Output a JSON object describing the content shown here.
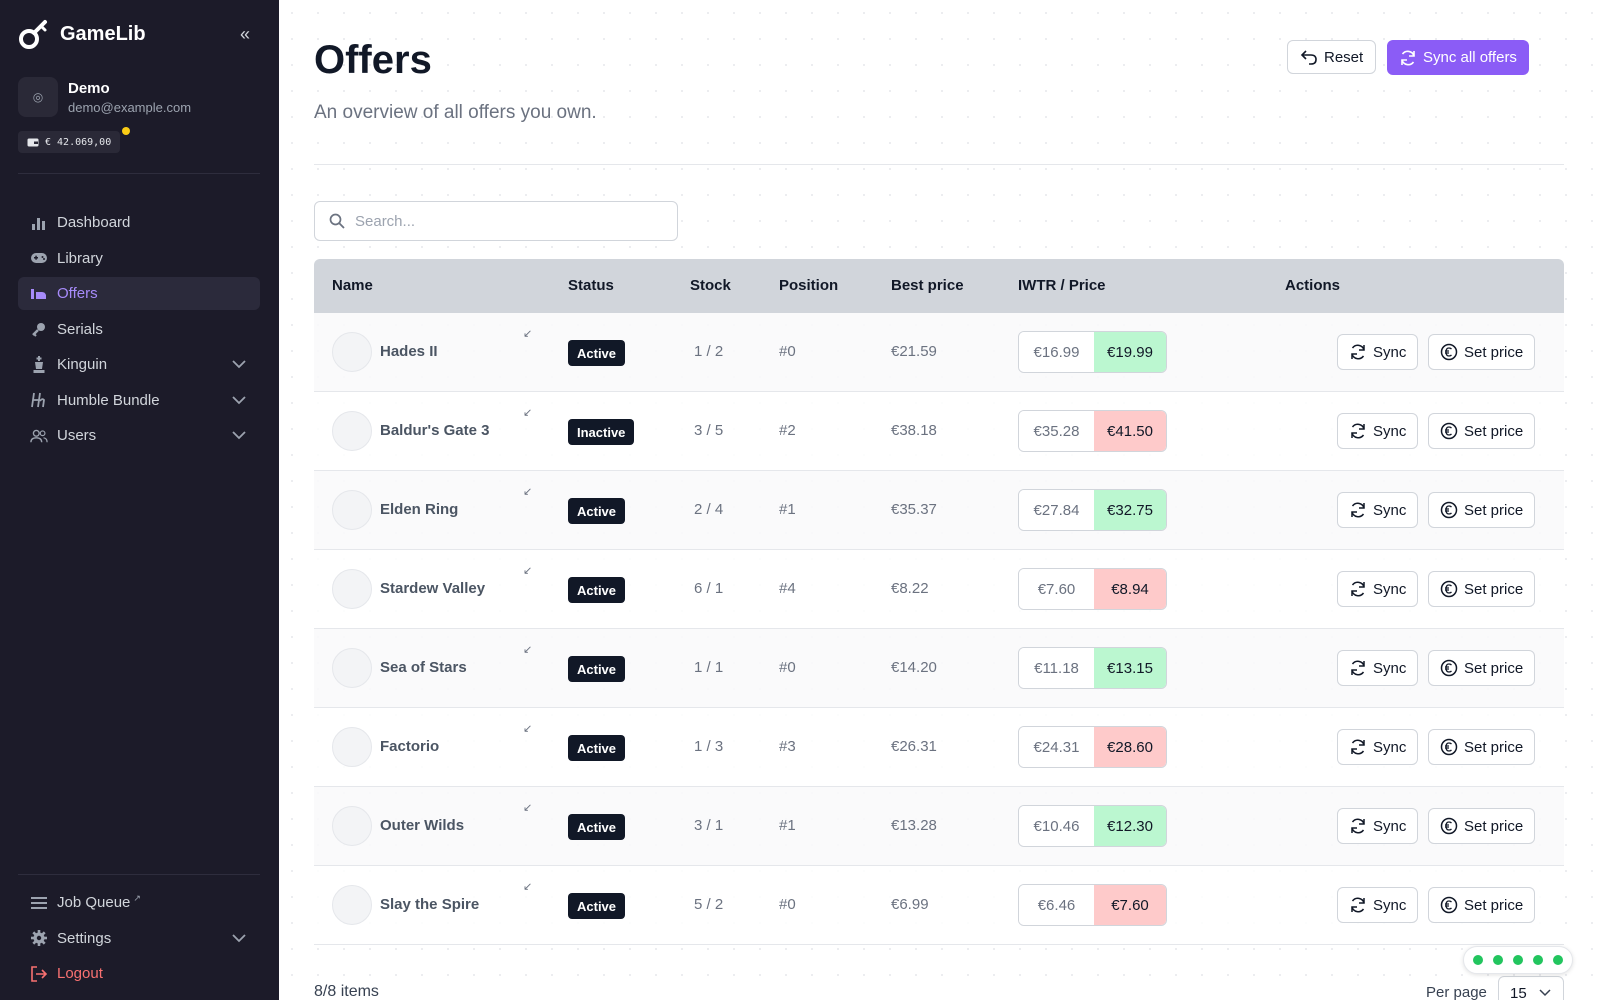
{
  "app": {
    "name": "GameLib"
  },
  "user": {
    "name": "Demo",
    "email": "demo@example.com",
    "wallet": "€ 42.069,00"
  },
  "nav": {
    "items": [
      {
        "label": "Dashboard",
        "icon": "bar-chart-icon"
      },
      {
        "label": "Library",
        "icon": "gamepad-icon"
      },
      {
        "label": "Offers",
        "icon": "offers-icon",
        "active": true
      },
      {
        "label": "Serials",
        "icon": "key-icon"
      },
      {
        "label": "Kinguin",
        "icon": "chess-king-icon",
        "expandable": true
      },
      {
        "label": "Humble Bundle",
        "icon": "humble-icon",
        "expandable": true
      },
      {
        "label": "Users",
        "icon": "users-icon",
        "expandable": true
      }
    ],
    "bottom": [
      {
        "label": "Job Queue",
        "icon": "list-icon"
      },
      {
        "label": "Settings",
        "icon": "gear-icon",
        "expandable": true
      },
      {
        "label": "Logout",
        "icon": "logout-icon"
      }
    ]
  },
  "page": {
    "title": "Offers",
    "subtitle": "An overview of all offers you own.",
    "reset_label": "Reset",
    "sync_all_label": "Sync all offers"
  },
  "search": {
    "placeholder": "Search..."
  },
  "table": {
    "columns": [
      "Name",
      "Status",
      "Stock",
      "Position",
      "Best price",
      "IWTR / Price",
      "Actions"
    ],
    "sync_label": "Sync",
    "set_price_label": "Set price",
    "rows": [
      {
        "name": "Hades II",
        "status": "Active",
        "stock": "1 / 2",
        "position": "#0",
        "best": "€21.59",
        "iwtr": "€16.99",
        "price": "€19.99",
        "price_state": "good"
      },
      {
        "name": "Baldur's Gate 3",
        "status": "Inactive",
        "stock": "3 / 5",
        "position": "#2",
        "best": "€38.18",
        "iwtr": "€35.28",
        "price": "€41.50",
        "price_state": "bad"
      },
      {
        "name": "Elden Ring",
        "status": "Active",
        "stock": "2 / 4",
        "position": "#1",
        "best": "€35.37",
        "iwtr": "€27.84",
        "price": "€32.75",
        "price_state": "good"
      },
      {
        "name": "Stardew Valley",
        "status": "Active",
        "stock": "6 / 1",
        "position": "#4",
        "best": "€8.22",
        "iwtr": "€7.60",
        "price": "€8.94",
        "price_state": "bad"
      },
      {
        "name": "Sea of Stars",
        "status": "Active",
        "stock": "1 / 1",
        "position": "#0",
        "best": "€14.20",
        "iwtr": "€11.18",
        "price": "€13.15",
        "price_state": "good"
      },
      {
        "name": "Factorio",
        "status": "Active",
        "stock": "1 / 3",
        "position": "#3",
        "best": "€26.31",
        "iwtr": "€24.31",
        "price": "€28.60",
        "price_state": "bad"
      },
      {
        "name": "Outer Wilds",
        "status": "Active",
        "stock": "3 / 1",
        "position": "#1",
        "best": "€13.28",
        "iwtr": "€10.46",
        "price": "€12.30",
        "price_state": "good"
      },
      {
        "name": "Slay the Spire",
        "status": "Active",
        "stock": "5 / 2",
        "position": "#0",
        "best": "€6.99",
        "iwtr": "€6.46",
        "price": "€7.60",
        "price_state": "bad"
      }
    ]
  },
  "footer": {
    "count": "8/8 items",
    "per_page_label": "Per page",
    "per_page_value": "15"
  },
  "colors": {
    "accent": "#8b5cf6",
    "sidebar_bg": "#1c1b29",
    "good": "#bbf7d0",
    "bad": "#fecaca",
    "logout": "#f87171"
  }
}
